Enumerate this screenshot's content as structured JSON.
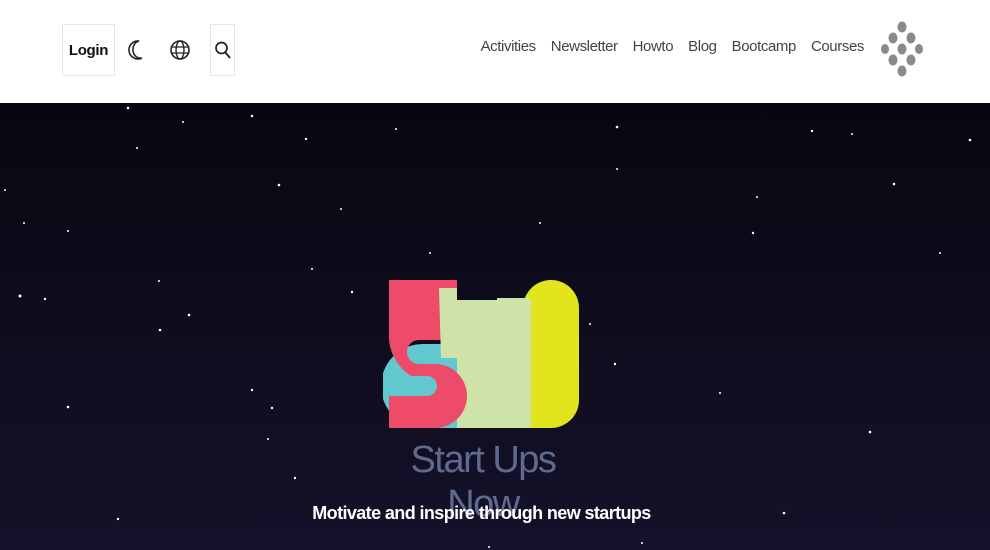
{
  "header": {
    "login_label": "Login",
    "theme_icon": "moon-icon",
    "language_icon": "globe-icon",
    "search_icon": "search-icon",
    "nav": [
      "Activities",
      "Newsletter",
      "Howto",
      "Blog",
      "Bootcamp",
      "Courses"
    ],
    "menu_icon": "dots-grid-icon"
  },
  "hero": {
    "brand": "Start Ups Now",
    "tagline": "Motivate and inspire through new startups",
    "logo_colors": {
      "s": "#ee4b6a",
      "u_overlap": "#61c8cf",
      "u": "#cfe3a9",
      "n": "#e2e41c"
    }
  }
}
